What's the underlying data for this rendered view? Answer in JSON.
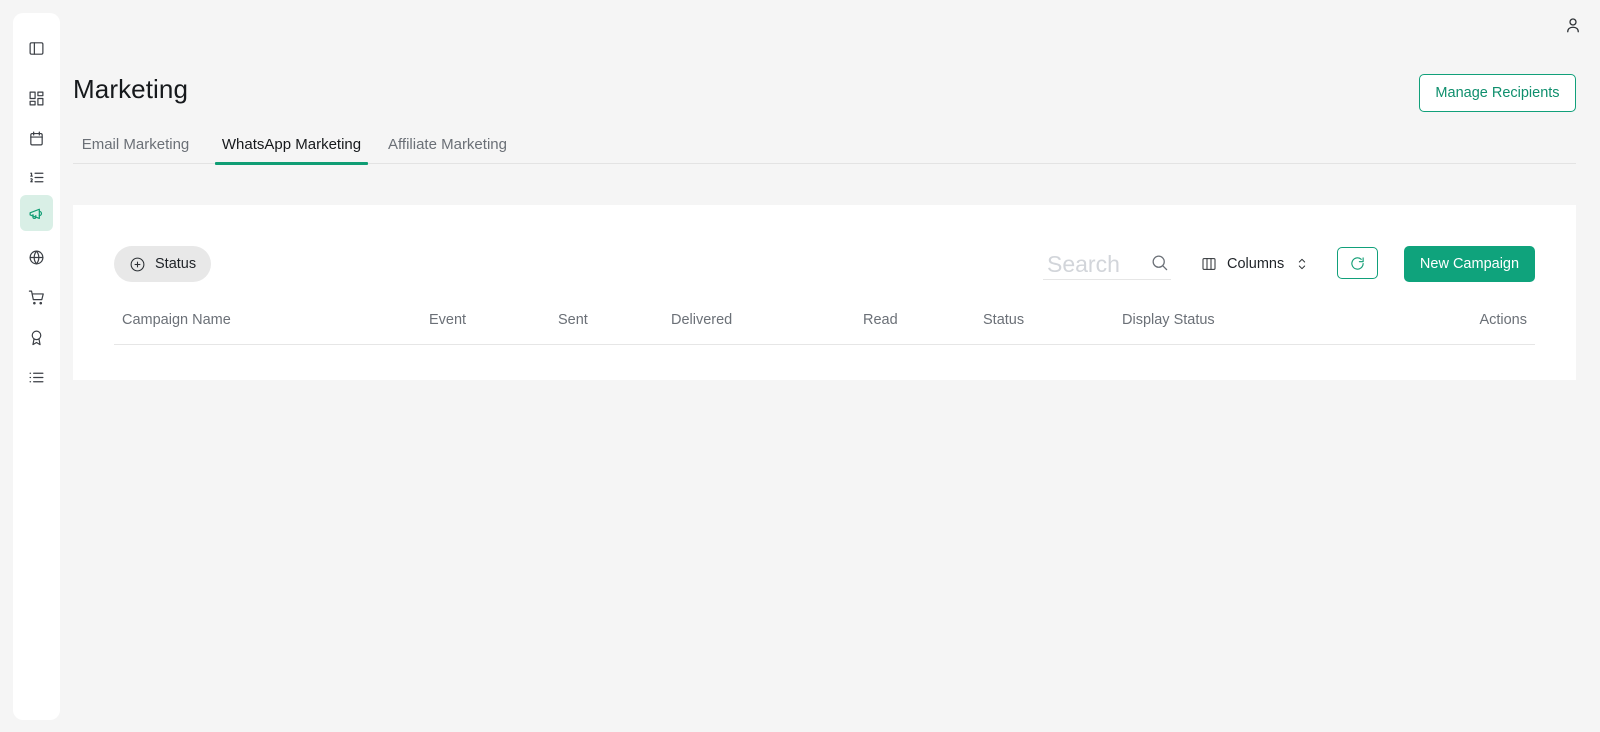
{
  "header": {
    "title": "Marketing",
    "manage_label": "Manage Recipients"
  },
  "sidebar": {
    "items": [
      {
        "icon": "panel-toggle-icon"
      },
      {
        "icon": "dashboard-icon"
      },
      {
        "icon": "calendar-icon"
      },
      {
        "icon": "ordered-list-icon"
      },
      {
        "icon": "megaphone-icon",
        "active": true
      },
      {
        "icon": "globe-icon"
      },
      {
        "icon": "cart-icon"
      },
      {
        "icon": "award-icon"
      },
      {
        "icon": "list-icon"
      }
    ]
  },
  "tabs": [
    {
      "label": "Email Marketing"
    },
    {
      "label": "WhatsApp Marketing",
      "active": true
    },
    {
      "label": "Affiliate Marketing"
    }
  ],
  "toolbar": {
    "status_filter": "Status",
    "search_placeholder": "Search",
    "columns_label": "Columns",
    "new_campaign_label": "New Campaign"
  },
  "table": {
    "columns": [
      "Campaign Name",
      "Event",
      "Sent",
      "Delivered",
      "Read",
      "Status",
      "Display Status",
      "Actions"
    ]
  },
  "colors": {
    "accent": "#0fa37c",
    "background": "#f5f5f5",
    "active_nav_bg": "#d9efe6"
  }
}
